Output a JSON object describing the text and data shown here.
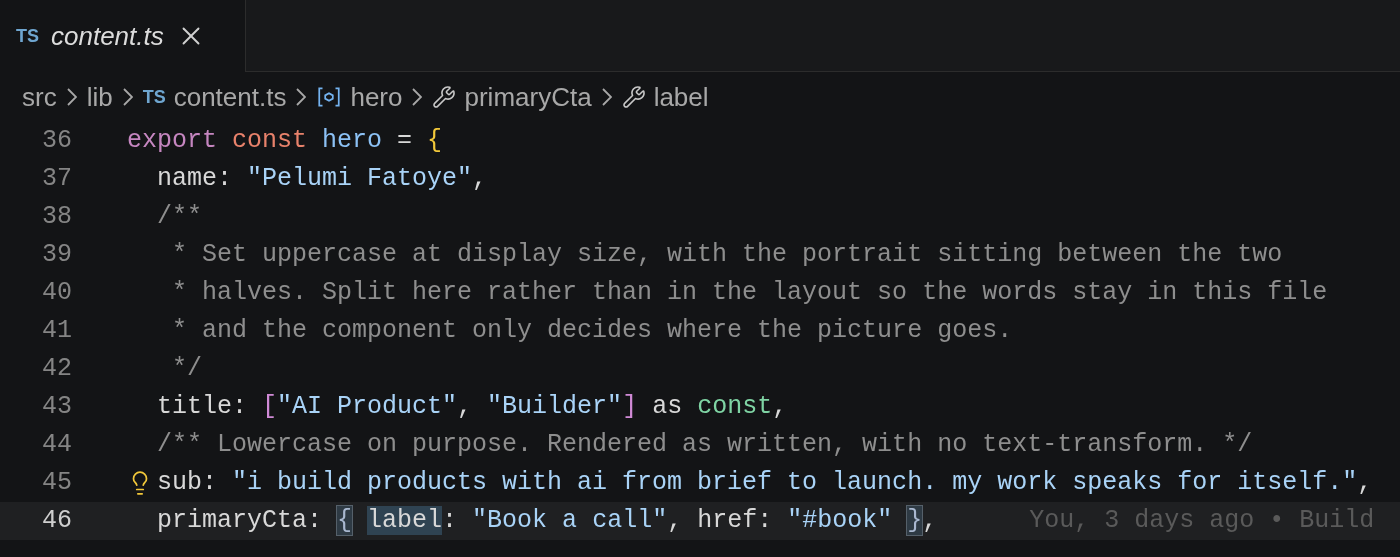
{
  "tab": {
    "badge": "TS",
    "label": "content.ts",
    "selected": true
  },
  "breadcrumbs": [
    {
      "kind": "folder",
      "label": "src"
    },
    {
      "kind": "folder",
      "label": "lib"
    },
    {
      "kind": "file",
      "badge": "TS",
      "label": "content.ts"
    },
    {
      "kind": "object",
      "label": "hero"
    },
    {
      "kind": "property",
      "label": "primaryCta"
    },
    {
      "kind": "property",
      "label": "label"
    }
  ],
  "lines": [
    {
      "number": "36",
      "current": false,
      "lightbulb": false,
      "tokens": [
        {
          "text": "export ",
          "kind": "keyword"
        },
        {
          "text": "const ",
          "kind": "storage"
        },
        {
          "text": "hero",
          "kind": "variable"
        },
        {
          "text": " = ",
          "kind": "plain"
        },
        {
          "text": "{",
          "kind": "brace"
        }
      ]
    },
    {
      "number": "37",
      "current": false,
      "lightbulb": false,
      "tokens": [
        {
          "text": "  name: ",
          "kind": "plain"
        },
        {
          "text": "\"Pelumi Fatoye\"",
          "kind": "string"
        },
        {
          "text": ",",
          "kind": "plain"
        }
      ]
    },
    {
      "number": "38",
      "current": false,
      "lightbulb": false,
      "tokens": [
        {
          "text": "  /**",
          "kind": "comment"
        }
      ]
    },
    {
      "number": "39",
      "current": false,
      "lightbulb": false,
      "tokens": [
        {
          "text": "   * Set uppercase at display size, with the portrait sitting between the two",
          "kind": "comment"
        }
      ]
    },
    {
      "number": "40",
      "current": false,
      "lightbulb": false,
      "tokens": [
        {
          "text": "   * halves. Split here rather than in the layout so the words stay in this file",
          "kind": "comment"
        }
      ]
    },
    {
      "number": "41",
      "current": false,
      "lightbulb": false,
      "tokens": [
        {
          "text": "   * and the component only decides where the picture goes.",
          "kind": "comment"
        }
      ]
    },
    {
      "number": "42",
      "current": false,
      "lightbulb": false,
      "tokens": [
        {
          "text": "   */",
          "kind": "comment"
        }
      ]
    },
    {
      "number": "43",
      "current": false,
      "lightbulb": false,
      "tokens": [
        {
          "text": "  title: ",
          "kind": "plain"
        },
        {
          "text": "[",
          "kind": "bracket"
        },
        {
          "text": "\"AI Product\"",
          "kind": "string"
        },
        {
          "text": ", ",
          "kind": "plain"
        },
        {
          "text": "\"Builder\"",
          "kind": "string"
        },
        {
          "text": "]",
          "kind": "bracket"
        },
        {
          "text": " as ",
          "kind": "plain"
        },
        {
          "text": "const",
          "kind": "type"
        },
        {
          "text": ",",
          "kind": "plain"
        }
      ]
    },
    {
      "number": "44",
      "current": false,
      "lightbulb": false,
      "tokens": [
        {
          "text": "  /** Lowercase on purpose. Rendered as written, with no text-transform. */",
          "kind": "comment"
        }
      ]
    },
    {
      "number": "45",
      "current": false,
      "lightbulb": true,
      "tokens": [
        {
          "text": "sub: ",
          "kind": "plain"
        },
        {
          "text": "\"i build products with ai from brief to launch. my work speaks for itself.\"",
          "kind": "string"
        },
        {
          "text": ",",
          "kind": "plain"
        }
      ]
    },
    {
      "number": "46",
      "current": true,
      "lightbulb": false,
      "blame": "You, 3 days ago • Build",
      "tokens": [
        {
          "text": "  primaryCta: ",
          "kind": "plain"
        },
        {
          "text": "{ ",
          "kind": "open-brace-match"
        },
        {
          "text": "label",
          "kind": "highlighted-word"
        },
        {
          "text": ": ",
          "kind": "plain"
        },
        {
          "text": "\"Book a call\"",
          "kind": "string"
        },
        {
          "text": ", href: ",
          "kind": "plain"
        },
        {
          "text": "\"#book\"",
          "kind": "string"
        },
        {
          "text": " }",
          "kind": "close-brace-match"
        },
        {
          "text": ",",
          "kind": "plain"
        }
      ]
    }
  ]
}
